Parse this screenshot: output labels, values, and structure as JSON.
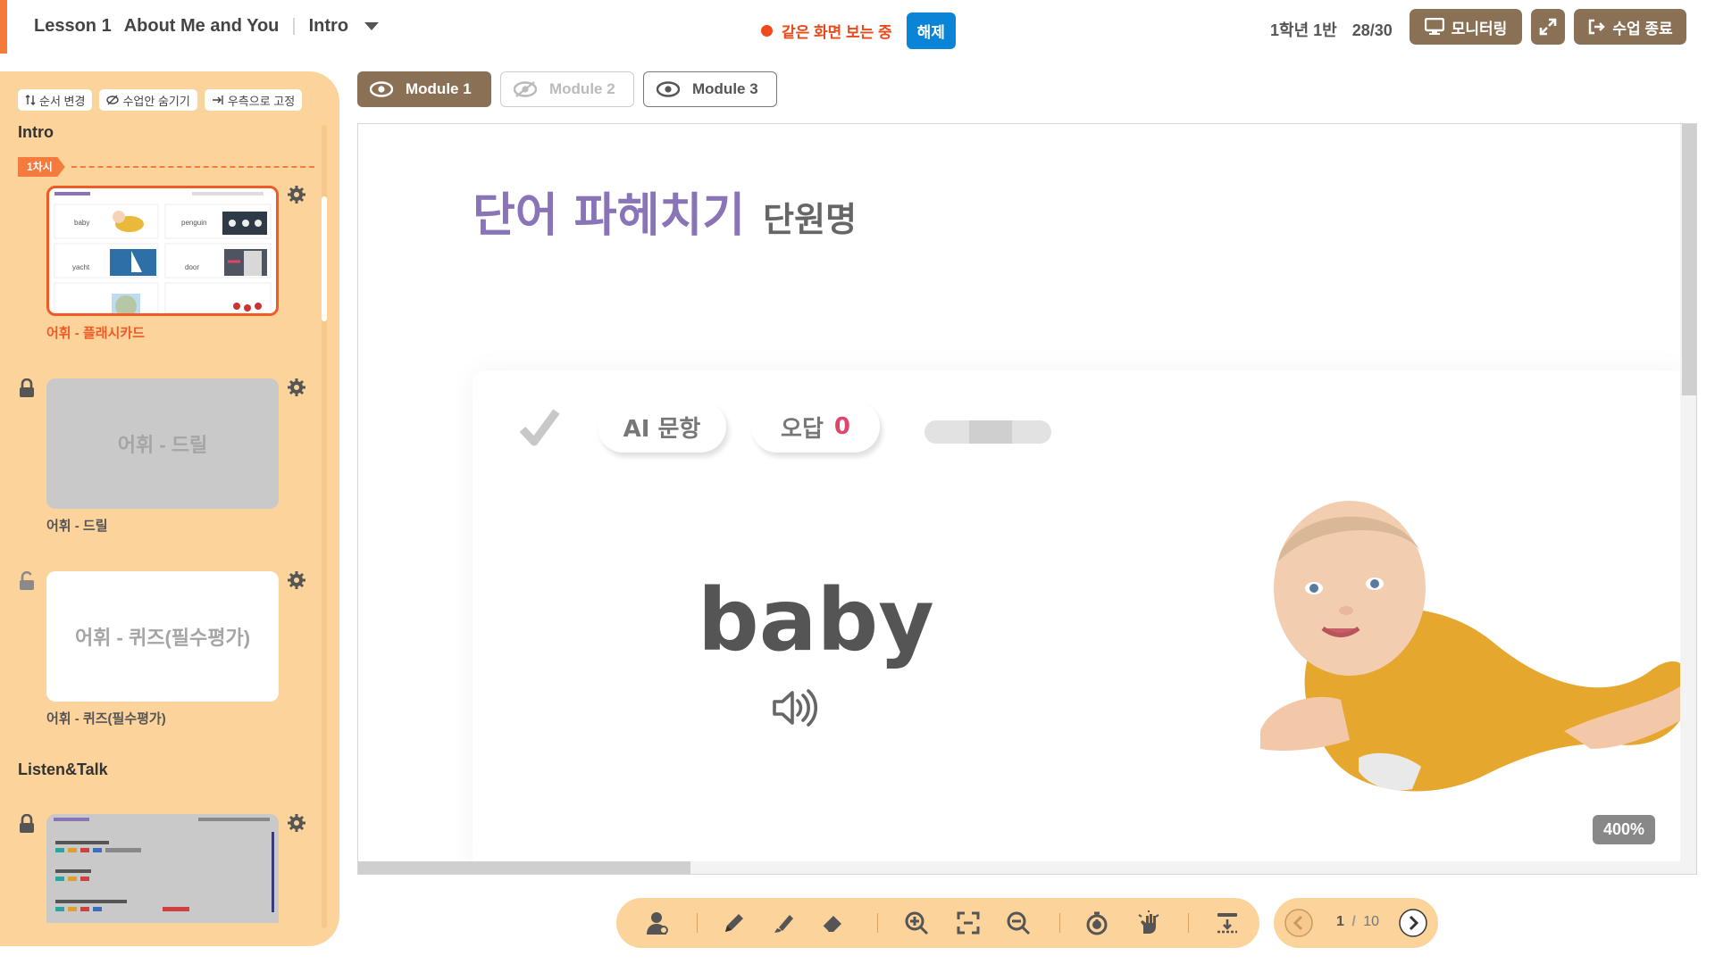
{
  "header": {
    "lesson": "Lesson 1",
    "lesson_title": "About Me and You",
    "section": "Intro",
    "live_status": "같은 화면 보는 중",
    "release_label": "해제",
    "class_name": "1학년 1반",
    "attendance": "28/30",
    "monitoring_label": "모니터링",
    "end_class_label": "수업 종료"
  },
  "sidebar": {
    "tools": [
      "순서 변경",
      "수업안 숨기기",
      "우측으로 고정"
    ],
    "section_intro": "Intro",
    "session_tag": "1차시",
    "items": [
      {
        "label": "어휘 - 플래시카드",
        "thumb_words": [
          "baby",
          "penguin",
          "yacht",
          "door"
        ]
      },
      {
        "label": "어휘 - 드릴",
        "placeholder": "어휘 - 드릴"
      },
      {
        "label": "어휘 - 퀴즈(필수평가)",
        "placeholder": "어휘 - 퀴즈(필수평가)"
      }
    ],
    "section_listen": "Listen&Talk"
  },
  "modules": [
    {
      "label": "Module 1"
    },
    {
      "label": "Module 2"
    },
    {
      "label": "Module 3"
    }
  ],
  "viewer": {
    "title": "단어 파헤치기",
    "subtitle": "단원명",
    "ai_label": "AI 문항",
    "wrong_label": "오답",
    "wrong_count": "0",
    "word": "baby",
    "zoom": "400%"
  },
  "pager": {
    "current": "1",
    "separator": "/",
    "total": "10"
  },
  "colors": {
    "accent": "#f47b3a",
    "brown": "#8a7156",
    "sidebar": "#fcd39a",
    "title_purple": "#8a74b8",
    "live_blue": "#0a84d6"
  }
}
